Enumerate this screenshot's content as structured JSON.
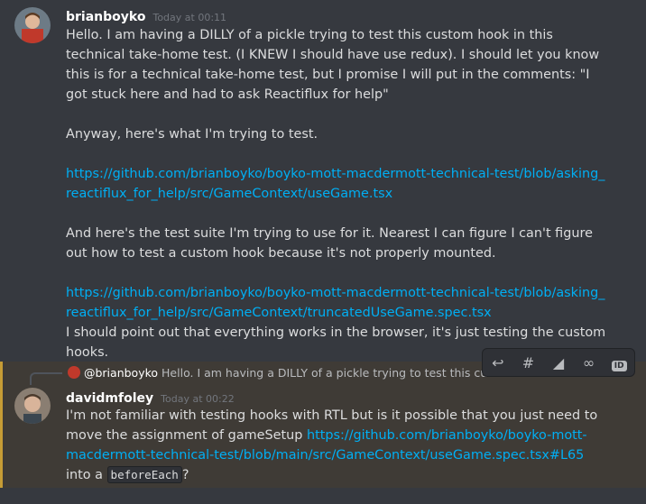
{
  "message1": {
    "username": "brianboyko",
    "timestamp": "Today at 00:11",
    "paragraph1": "Hello.  I am having a DILLY of a pickle trying to test this custom hook in this technical take-home test.  (I KNEW I should have use redux). I should let you know this is for a technical take-home test, but I promise I will put in the comments: \"I got stuck here and had to ask Reactiflux for help\"",
    "paragraph2": "Anyway, here's what I'm trying to test.",
    "link1": "https://github.com/brianboyko/boyko-mott-macdermott-technical-test/blob/asking_reactiflux_for_help/src/GameContext/useGame.tsx",
    "paragraph3": "And here's the test suite I'm trying to use for it.  Nearest I can figure I can't figure out how to test a custom hook because it's not properly mounted.",
    "link2": "https://github.com/brianboyko/boyko-mott-macdermott-technical-test/blob/asking_reactiflux_for_help/src/GameContext/truncatedUseGame.spec.tsx",
    "paragraph4": "I should point out that everything works in the browser, it's just testing the custom hooks."
  },
  "message2": {
    "reply_mention": "@brianboyko",
    "reply_preview": "Hello.  I am having a DILLY of a pickle trying to test this custom",
    "username": "davidmfoley",
    "timestamp": "Today at 00:22",
    "text_before_link": "I'm not familiar with testing hooks with RTL but is it possible that you just need to move the assignment of gameSetup ",
    "link": "https://github.com/brianboyko/boyko-mott-macdermott-technical-test/blob/main/src/GameContext/useGame.spec.tsx#L65",
    "text_after_link": " into a ",
    "code": "beforeEach",
    "text_end": "?"
  },
  "toolbar": {
    "icons": [
      "reply-icon",
      "thread-icon",
      "tag-icon",
      "link-icon",
      "id-icon"
    ],
    "id_label": "ID"
  },
  "colors": {
    "background": "#36393f",
    "highlight": "#3f3b36",
    "highlight_border": "#c69c35",
    "link": "#00aff4"
  }
}
